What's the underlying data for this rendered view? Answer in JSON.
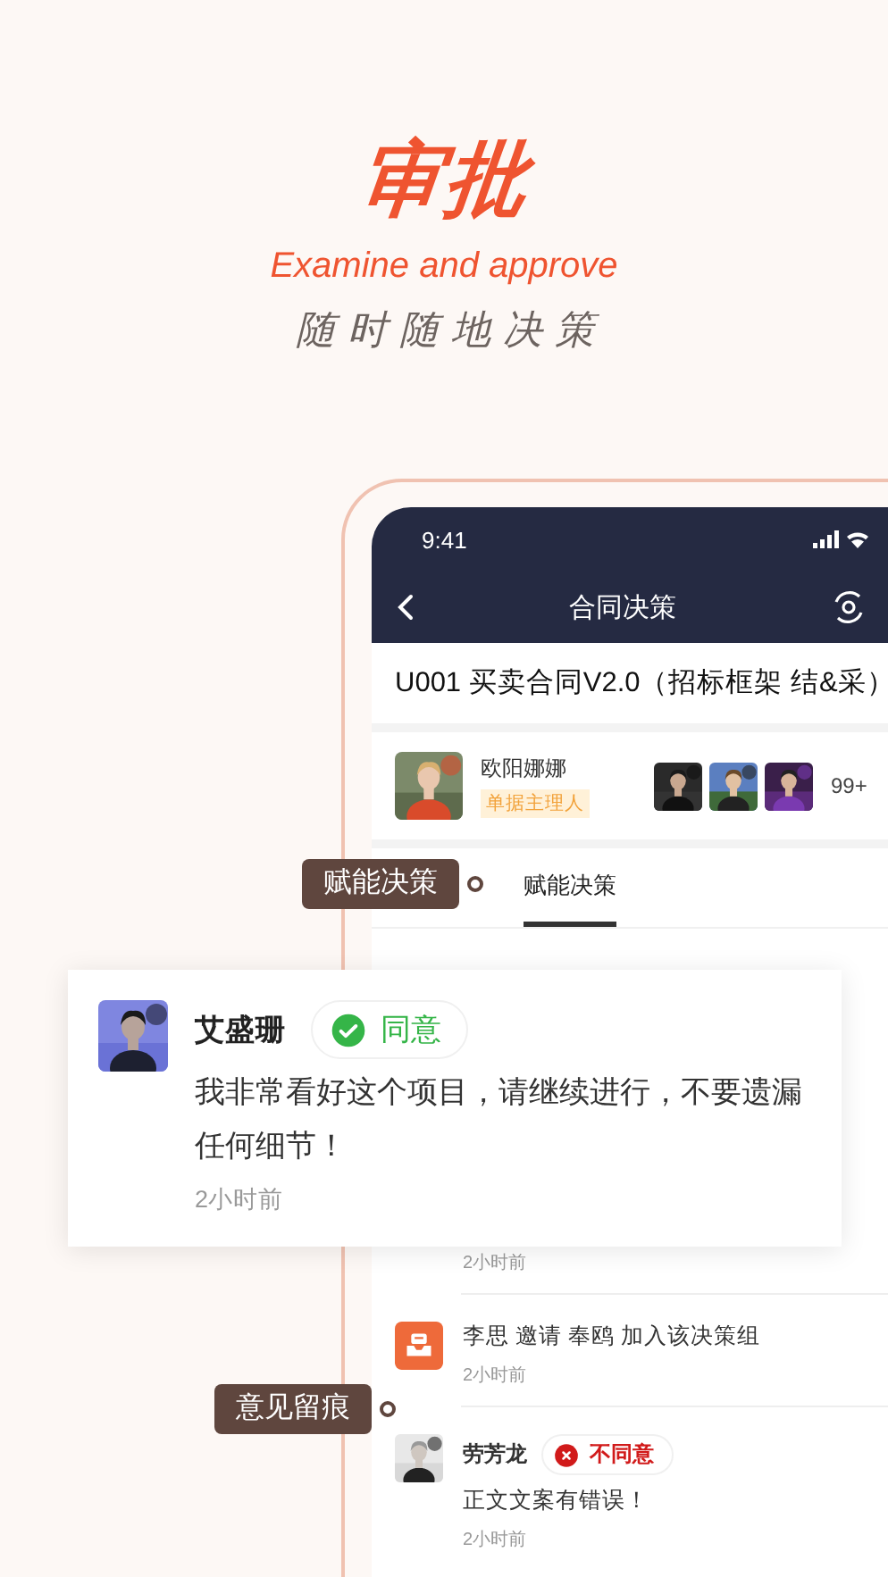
{
  "hero": {
    "title": "审批",
    "subtitle": "Examine and approve",
    "tagline": "随时随地决策"
  },
  "phone": {
    "status_bar": {
      "time": "9:41"
    },
    "nav": {
      "title": "合同决策"
    },
    "document_title": "U001 买卖合同V2.0（招标框架 结&采）",
    "owner": {
      "name": "欧阳娜娜",
      "role": "单据主理人"
    },
    "participants": {
      "count": "99+"
    },
    "tabs": [
      {
        "label": "赋能决策",
        "selected": true
      }
    ],
    "feed": [
      {
        "kind": "timestamp",
        "time": "2小时前"
      },
      {
        "kind": "event",
        "text": "李思 邀请 奉鸥 加入该决策组",
        "time": "2小时前"
      },
      {
        "kind": "comment",
        "name": "劳芳龙",
        "status": {
          "kind": "disagree",
          "label": "不同意"
        },
        "text": "正文文案有错误！",
        "time": "2小时前"
      }
    ]
  },
  "callouts": [
    {
      "label": "赋能决策"
    },
    {
      "label": "意见留痕"
    }
  ],
  "featured_comment": {
    "name": "艾盛珊",
    "status": {
      "kind": "agree",
      "label": "同意"
    },
    "text": "我非常看好这个项目，请继续进行，不要遗漏任何细节！",
    "time": "2小时前"
  }
}
